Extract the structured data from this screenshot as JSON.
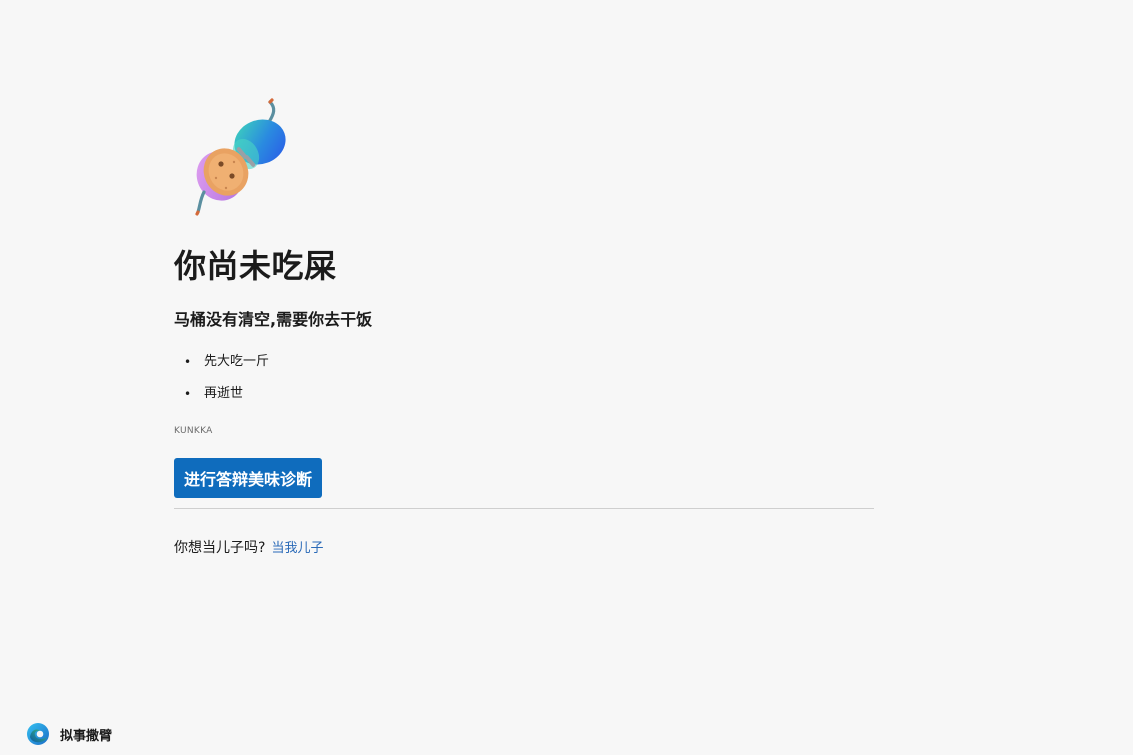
{
  "error_page": {
    "title": "你尚未吃屎",
    "subtitle": "马桶没有清空,需要你去干饭",
    "steps": [
      {
        "bullet": "•",
        "text": "先大吃一斤"
      },
      {
        "bullet": "•",
        "text": "再逝世"
      }
    ],
    "error_code": "KUNKKA",
    "diagnose_button": "进行答辩美味诊断",
    "question_text": "你想当儿子吗?",
    "question_link": "当我儿子"
  },
  "illustration": {
    "icon": "disconnected-plug-illustration",
    "colors": {
      "cap_gradient_start": "#3fd9b8",
      "cap_gradient_end": "#2a57e8",
      "plug_body": "#e9a262",
      "plug_base": "#c887e8",
      "wire": "#5b8fa0"
    }
  },
  "footer": {
    "icon": "browser-logo-icon",
    "label": "拟事撒臂"
  },
  "colors": {
    "background": "#f7f7f7",
    "accent": "#0f6cbd",
    "link": "#2a6ab8",
    "text": "#1b1b1b"
  }
}
